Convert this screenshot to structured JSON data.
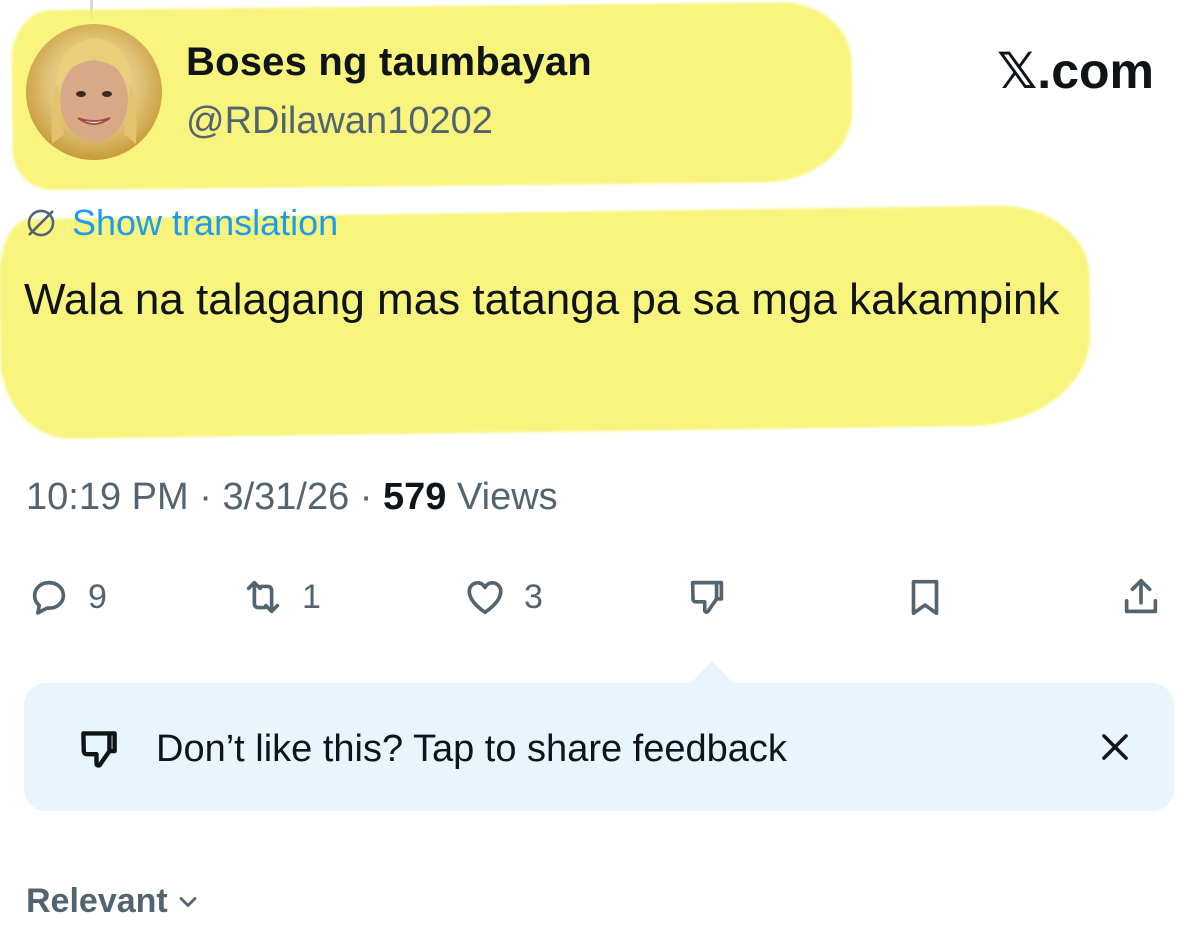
{
  "author": {
    "display_name": "Boses ng taumbayan",
    "handle": "@RDilawan10202"
  },
  "brand": {
    "site": ".com",
    "logo_glyph": "𝕏"
  },
  "translate": {
    "label": "Show translation",
    "icon": "globe-slash-icon",
    "color": "#1d9bf0"
  },
  "tweet": {
    "text": "Wala na talagang mas tatanga pa sa mga kakampink"
  },
  "meta": {
    "time": "10:19 PM",
    "separator": "·",
    "date": "3/31/26",
    "views_count": "579",
    "views_label": "Views"
  },
  "actions": {
    "reply": {
      "icon": "reply-icon",
      "count": "9"
    },
    "repost": {
      "icon": "repost-icon",
      "count": "1"
    },
    "like": {
      "icon": "heart-icon",
      "count": "3"
    },
    "dislike": {
      "icon": "thumbs-down-icon"
    },
    "bookmark": {
      "icon": "bookmark-icon"
    },
    "share": {
      "icon": "share-icon"
    }
  },
  "feedback": {
    "text": "Don’t like this? Tap to share feedback",
    "icon": "thumbs-down-icon",
    "close_icon": "close-icon",
    "background": "#e8f5fd"
  },
  "sort": {
    "label": "Relevant",
    "icon": "chevron-down-icon"
  },
  "colors": {
    "highlight": "#f7f25a",
    "secondary_text": "#536471",
    "primary_text": "#0f1419"
  }
}
